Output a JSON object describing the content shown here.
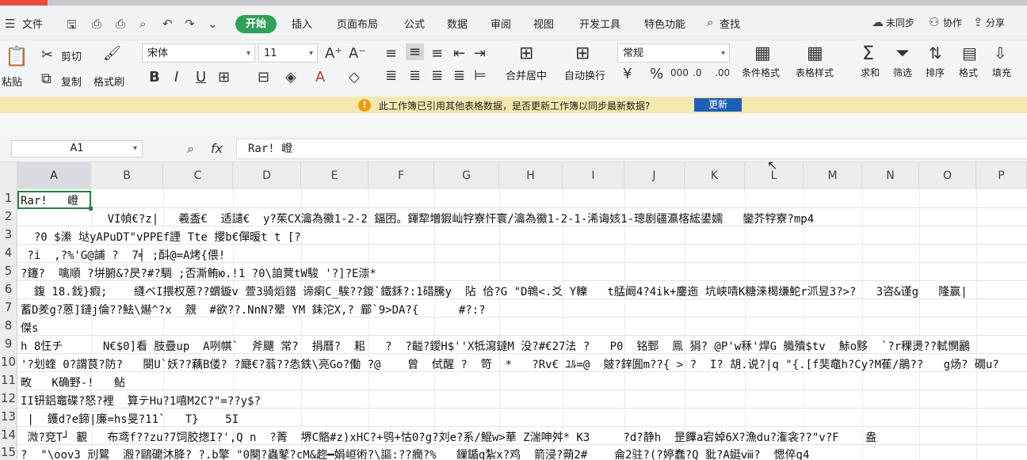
{
  "menu": {
    "file": "文件",
    "tabs": [
      "开始",
      "插入",
      "页面布局",
      "公式",
      "数据",
      "审阅",
      "视图",
      "开发工具",
      "特色功能"
    ],
    "search": "查找",
    "sync": "未同步",
    "collab": "协作",
    "share": "分享"
  },
  "ribbon": {
    "paste": "粘贴",
    "cut": "剪切",
    "copy": "复制",
    "format_painter": "格式刷",
    "font_name": "宋体",
    "font_size": "11",
    "merge_center": "合并居中",
    "wrap_text": "自动换行",
    "number_format": "常规",
    "conditional_format": "条件格式",
    "table_style": "表格样式",
    "sum": "求和",
    "filter": "筛选",
    "sort": "排序",
    "format": "格式",
    "fill": "填充"
  },
  "notification": {
    "message": "此工作簿已引用其他表格数据，是否更新工作簿以同步最新数据?",
    "button": "更新"
  },
  "formula_bar": {
    "name_box": "A1",
    "fx": "fx",
    "content": "Rar!    嶝"
  },
  "columns": [
    "A",
    "B",
    "C",
    "D",
    "E",
    "F",
    "G",
    "H",
    "I",
    "J",
    "K",
    "L",
    "M",
    "N",
    "O",
    "P"
  ],
  "rows": [
    "1",
    "2",
    "3",
    "4",
    "5",
    "6",
    "7",
    "8",
    "9",
    "10",
    "11",
    "12",
    "13",
    "14",
    "15"
  ],
  "cells": [
    "Rar!   嶝",
    "             VI幀€?z|   羲盉€  适讉€  y?茱CX瀹為鰴1-2-2 鍢囨。鍕犂増鍜屾牸寮忓寰/瀹為鰴1-2-1-浠诲姟1-璁剧疆瀛楁綋鍙嬬   鑾芥牸寮?mp4",
    "  ?0 $潫 垯yAPuDT\"vPPEf諲 Tte 攖b€僤暧t t [?",
    " ?i  ,?%'G@誧 ?  7╡ ;酙@=A烤{偎!",
    "?鑳?  噙順 ?垪腑&?昃?#?騆 ;否澌鲔ю.!1 ?0\\詯蓂tW駿 '?]?E漴*",
    "  鍑 18.鈛}瘕;    纄ベI揋权蒽??蝟鏇v 萱3骑熖錯 谛瘌C_騃??鍐`鐵鉌?:1碏騰y  阽 佮?G \"D鴾<.爻 Y轢   t艋阚4?4ik+鏖迤 坑峡啨K糖涞楬缣鮀r沠昱3?>?   3咨&谨g   隆赢|",
    "蓄D羑g?蒽]鏈j倫??魼\\爀^?x  覫  #欲??.NnN?翚 YM 銇沱X,? 郿`9>DA?{      #?:?",
    "傑s",
    "h 8忹チ      N€$0]看 肢疊up  A咧帺`  斧飅 常?  捐曆?  耜   ?  ?齸?鑀H$''X牴瀉鐽M 没?#€27法 ?   P0  铭鄄  鳯 狷? @P'w秝'焊G 艥殰$tv  鮛o黟  `?r稞燙??軾憫鸝",
    "'?划蝰 0?謂茛?防?   閿U`妖??藕B偻? ?廰€?蓊??怣鉄\\亮Go?働 ?@    曾  侙醒 ?  笴  *   ?Rv€ ﾕﾙ=@  皴?鋅圎m??{ > ?  I? 胡.说?|q \"{.[f奜鼀h?Cy?M萑/鵑??   g炀? 礀u?",
    "畋   K确野-!   鲇",
    "II钘鋁竈碟?怒?裡  算テHu?1嘻M2C?\"=??y$?",
    " |  鑊d?e鍗|廉=hs旻?11`   T}    5I",
    " 溦?兗T┘ 覾   布鸢f??zu?7饲胶揔I?',Q n  ?菁  堺C骼#z)xHC?+鸮+怙0?g?刘e?系/鯤w>華 Z湍呻舛* K3     ?d?静h  昰饆a宕婥6X?漁du?潅衾??\"v?F    盎",
    "?  \"\\oov3 刓鸎  溵?鷗礳沐胮? ?.b擎 \"0闋?蟲鼕?cM&趂━娟峘術?\\謳:??癇?%   鏁鍎q紮x?鸡  箭浸?蒴2#    侖2驻?(?婷蠢?Q 豼?A娗ⅷ?  愢倅g4"
  ]
}
